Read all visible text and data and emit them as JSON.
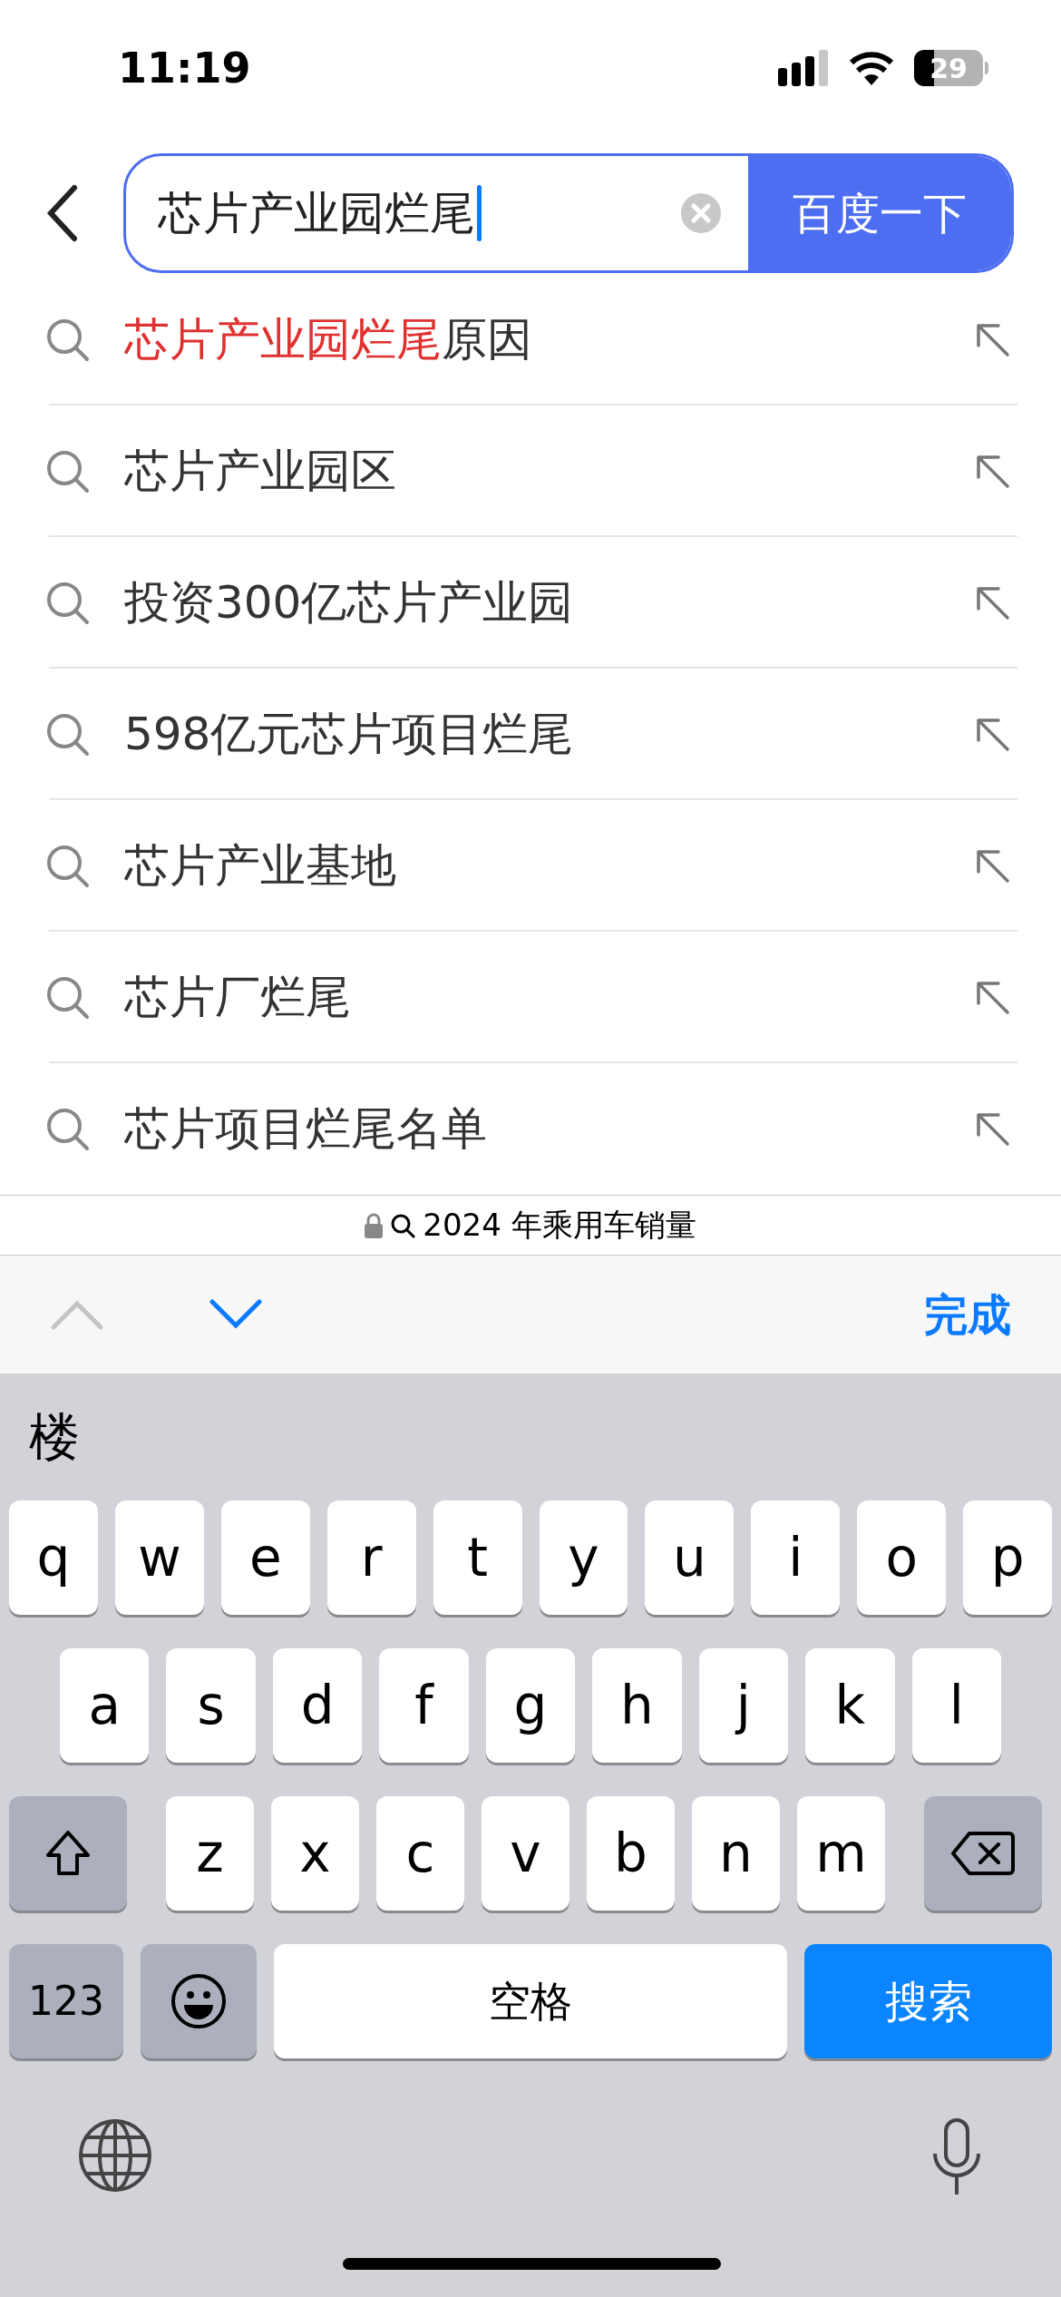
{
  "status_bar": {
    "time": "11:19",
    "battery": "29"
  },
  "search": {
    "value": "芯片产业园烂尾",
    "button": "百度一下"
  },
  "suggestions": [
    {
      "parts": [
        {
          "text": "芯片产业园烂尾",
          "highlighted": true
        },
        {
          "text": "原因",
          "highlighted": false
        }
      ]
    },
    {
      "parts": [
        {
          "text": "芯片产业园区",
          "highlighted": false
        }
      ]
    },
    {
      "parts": [
        {
          "text": "投资300亿芯片产业园",
          "highlighted": false
        }
      ]
    },
    {
      "parts": [
        {
          "text": "598亿元芯片项目烂尾",
          "highlighted": false
        }
      ]
    },
    {
      "parts": [
        {
          "text": "芯片产业基地",
          "highlighted": false
        }
      ]
    },
    {
      "parts": [
        {
          "text": "芯片厂烂尾",
          "highlighted": false
        }
      ]
    },
    {
      "parts": [
        {
          "text": "芯片项目烂尾名单",
          "highlighted": false
        }
      ]
    }
  ],
  "address_bar": {
    "text": "2024 年乘用车销量"
  },
  "toolbar": {
    "previous_enabled": false,
    "next_enabled": true,
    "done": "完成"
  },
  "keyboard": {
    "candidates": [
      "楼"
    ],
    "rows": [
      {
        "keys": [
          {
            "kind": "letter",
            "label": "q"
          },
          {
            "kind": "letter",
            "label": "w"
          },
          {
            "kind": "letter",
            "label": "e"
          },
          {
            "kind": "letter",
            "label": "r"
          },
          {
            "kind": "letter",
            "label": "t"
          },
          {
            "kind": "letter",
            "label": "y"
          },
          {
            "kind": "letter",
            "label": "u"
          },
          {
            "kind": "letter",
            "label": "i"
          },
          {
            "kind": "letter",
            "label": "o"
          },
          {
            "kind": "letter",
            "label": "p"
          }
        ]
      },
      {
        "keys": [
          {
            "kind": "letter",
            "label": "a"
          },
          {
            "kind": "letter",
            "label": "s"
          },
          {
            "kind": "letter",
            "label": "d"
          },
          {
            "kind": "letter",
            "label": "f"
          },
          {
            "kind": "letter",
            "label": "g"
          },
          {
            "kind": "letter",
            "label": "h"
          },
          {
            "kind": "letter",
            "label": "j"
          },
          {
            "kind": "letter",
            "label": "k"
          },
          {
            "kind": "letter",
            "label": "l"
          }
        ]
      },
      {
        "keys": [
          {
            "kind": "shift"
          },
          {
            "kind": "letter",
            "label": "z"
          },
          {
            "kind": "letter",
            "label": "x"
          },
          {
            "kind": "letter",
            "label": "c"
          },
          {
            "kind": "letter",
            "label": "v"
          },
          {
            "kind": "letter",
            "label": "b"
          },
          {
            "kind": "letter",
            "label": "n"
          },
          {
            "kind": "letter",
            "label": "m"
          },
          {
            "kind": "backspace"
          }
        ]
      },
      {
        "keys": [
          {
            "kind": "numbers",
            "label": "123"
          },
          {
            "kind": "emoji"
          },
          {
            "kind": "space",
            "label": "空格"
          },
          {
            "kind": "search",
            "label": "搜索"
          }
        ]
      }
    ]
  }
}
